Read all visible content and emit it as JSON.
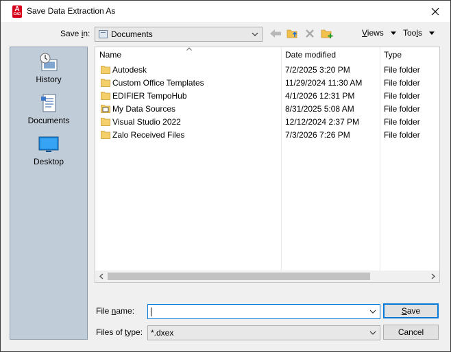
{
  "window": {
    "title": "Save Data Extraction As"
  },
  "toolbar": {
    "save_in_label_pre": "Save ",
    "save_in_label_key": "i",
    "save_in_label_post": "n:",
    "save_in_value": "Documents",
    "views_label": "Views",
    "views_key": "V",
    "views_rest": "iews",
    "tools_label": "Tools",
    "tools_key": "l",
    "tools_pre": "Too",
    "tools_post": "s"
  },
  "places": [
    {
      "label": "History"
    },
    {
      "label": "Documents"
    },
    {
      "label": "Desktop"
    }
  ],
  "columns": {
    "name": "Name",
    "date": "Date modified",
    "type": "Type"
  },
  "files": [
    {
      "name": "Autodesk",
      "date": "7/2/2025 3:20 PM",
      "type": "File folder",
      "icon": "folder-icon"
    },
    {
      "name": "Custom Office Templates",
      "date": "11/29/2024 11:30 AM",
      "type": "File folder",
      "icon": "folder-icon"
    },
    {
      "name": "EDIFIER TempoHub",
      "date": "4/1/2026 12:31 PM",
      "type": "File folder",
      "icon": "folder-icon"
    },
    {
      "name": "My Data Sources",
      "date": "8/31/2025 5:08 AM",
      "type": "File folder",
      "icon": "data-sources-folder-icon"
    },
    {
      "name": "Visual Studio 2022",
      "date": "12/12/2024 2:37 PM",
      "type": "File folder",
      "icon": "folder-icon"
    },
    {
      "name": "Zalo Received Files",
      "date": "7/3/2026 7:26 PM",
      "type": "File folder",
      "icon": "folder-icon"
    }
  ],
  "form": {
    "file_name_pre": "File ",
    "file_name_key": "n",
    "file_name_post": "ame:",
    "file_name_value": "",
    "file_type_pre": "Files of ",
    "file_type_key": "t",
    "file_type_post": "ype:",
    "file_type_value": "*.dxex",
    "save_pre": "",
    "save_key": "S",
    "save_post": "ave",
    "cancel_label": "Cancel"
  },
  "colors": {
    "accent": "#0078d7",
    "places_bg": "#c0ccd8",
    "folder": "#f5cf6a",
    "app_icon": "#d6001c"
  }
}
